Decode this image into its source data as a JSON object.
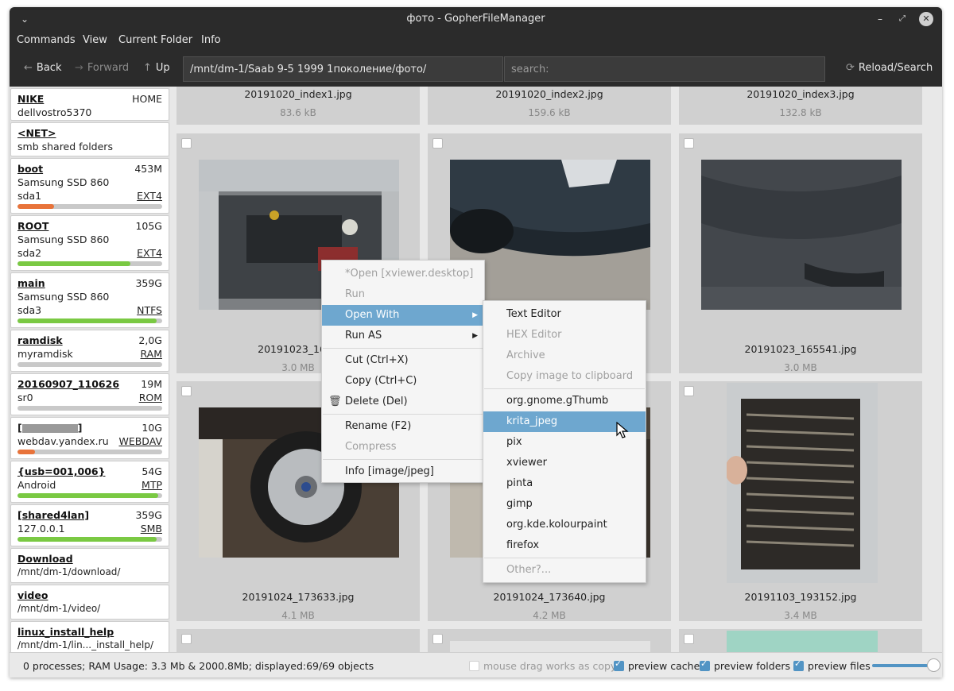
{
  "window": {
    "title": "фото - GopherFileManager"
  },
  "menubar": [
    "Commands",
    "View",
    "Current Folder",
    "Info"
  ],
  "toolbar": {
    "back": "Back",
    "forward": "Forward",
    "up": "Up",
    "path": "/mnt/dm-1/Saab 9-5 1999 1поколение/фото/",
    "search_placeholder": "search:",
    "reload": "Reload/Search"
  },
  "sidebar": [
    {
      "name": "NIKE",
      "size": "HOME",
      "line2": "dellvostro5370"
    },
    {
      "name": "<NET>",
      "line2": "smb shared folders"
    },
    {
      "name": "boot",
      "size": "453M",
      "line2": "Samsung SSD 860",
      "line3": "sda1",
      "fs": "EXT4",
      "usage": 0.25,
      "bar_color": "#e8733a"
    },
    {
      "name": "ROOT",
      "size": "105G",
      "line2": "Samsung SSD 860",
      "line3": "sda2",
      "fs": "EXT4",
      "usage": 0.78,
      "bar_color": "#7ac943"
    },
    {
      "name": "main",
      "size": "359G",
      "line2": "Samsung SSD 860",
      "line3": "sda3",
      "fs": "NTFS",
      "usage": 0.96,
      "bar_color": "#7ac943"
    },
    {
      "name": "ramdisk",
      "size": "2,0G",
      "line2": "myramdisk",
      "fs": "RAM",
      "usage": 0.0,
      "bar_color": "#7ac943"
    },
    {
      "name": "20160907_110626",
      "size": "19M",
      "line2": "sr0",
      "fs": "ROM",
      "usage": 0.0,
      "bar_color": "#7ac943"
    },
    {
      "name": "",
      "size": "10G",
      "line2": "webdav.yandex.ru",
      "fs": "WEBDAV",
      "usage": 0.12,
      "bar_color": "#e8733a",
      "redacted": true
    },
    {
      "name": "{usb=001,006}",
      "size": "54G",
      "line2": "Android",
      "fs": "MTP",
      "usage": 0.97,
      "bar_color": "#7ac943"
    },
    {
      "name": "[shared4lan]",
      "size": "359G",
      "line2": "127.0.0.1",
      "fs": "SMB",
      "usage": 0.96,
      "bar_color": "#7ac943"
    },
    {
      "name": "Download",
      "line2": "/mnt/dm-1/download/"
    },
    {
      "name": "video",
      "line2": "/mnt/dm-1/video/"
    },
    {
      "name": "linux_install_help",
      "line2": "/mnt/dm-1/lin..._install_help/"
    }
  ],
  "files": [
    {
      "name": "20191020_index1.jpg",
      "size": "83.6 kB"
    },
    {
      "name": "20191020_index2.jpg",
      "size": "159.6 kB"
    },
    {
      "name": "20191020_index3.jpg",
      "size": "132.8 kB"
    },
    {
      "name": "20191023_1625",
      "size": "3.0 MB"
    },
    {
      "name": "",
      "size": ""
    },
    {
      "name": "20191023_165541.jpg",
      "size": "3.0 MB"
    },
    {
      "name": "20191024_173633.jpg",
      "size": "4.1 MB"
    },
    {
      "name": "20191024_173640.jpg",
      "size": "4.2 MB"
    },
    {
      "name": "20191103_193152.jpg",
      "size": "3.4 MB"
    }
  ],
  "context_menu": [
    {
      "label": "*Open [xviewer.desktop]",
      "disabled": true
    },
    {
      "label": "Run",
      "disabled": true
    },
    {
      "label": "Open With",
      "highlight": true,
      "submenu": true
    },
    {
      "label": "Run AS",
      "submenu": true
    },
    {
      "label": "Cut (Ctrl+X)"
    },
    {
      "label": "Copy (Ctrl+C)"
    },
    {
      "label": "Delete (Del)",
      "icon": "trash-icon"
    },
    {
      "label": "Rename (F2)"
    },
    {
      "label": "Compress",
      "disabled": true
    },
    {
      "label": "Info [image/jpeg]"
    }
  ],
  "open_with_menu": [
    {
      "label": "Text Editor"
    },
    {
      "label": "HEX Editor",
      "disabled": true
    },
    {
      "label": "Archive",
      "disabled": true
    },
    {
      "label": "Copy image to clipboard",
      "disabled": true
    },
    {
      "label": "org.gnome.gThumb"
    },
    {
      "label": "krita_jpeg",
      "highlight": true
    },
    {
      "label": "pix"
    },
    {
      "label": "xviewer"
    },
    {
      "label": "pinta"
    },
    {
      "label": "gimp"
    },
    {
      "label": "org.kde.kolourpaint"
    },
    {
      "label": "firefox"
    },
    {
      "label": "Other?...",
      "disabled": true
    }
  ],
  "statusbar": {
    "info": "0 processes; RAM Usage: 3.3 Mb & 2000.8Mb; displayed:69/69 objects",
    "drag_copy": "mouse drag works as copy",
    "preview_cache": "preview cache",
    "preview_folders": "preview folders",
    "preview_files": "preview files"
  },
  "colors": {
    "titlebar": "#2b2b2b",
    "accent": "#6ea7cf",
    "bar_ok": "#7ac943",
    "bar_warn": "#e8733a"
  }
}
